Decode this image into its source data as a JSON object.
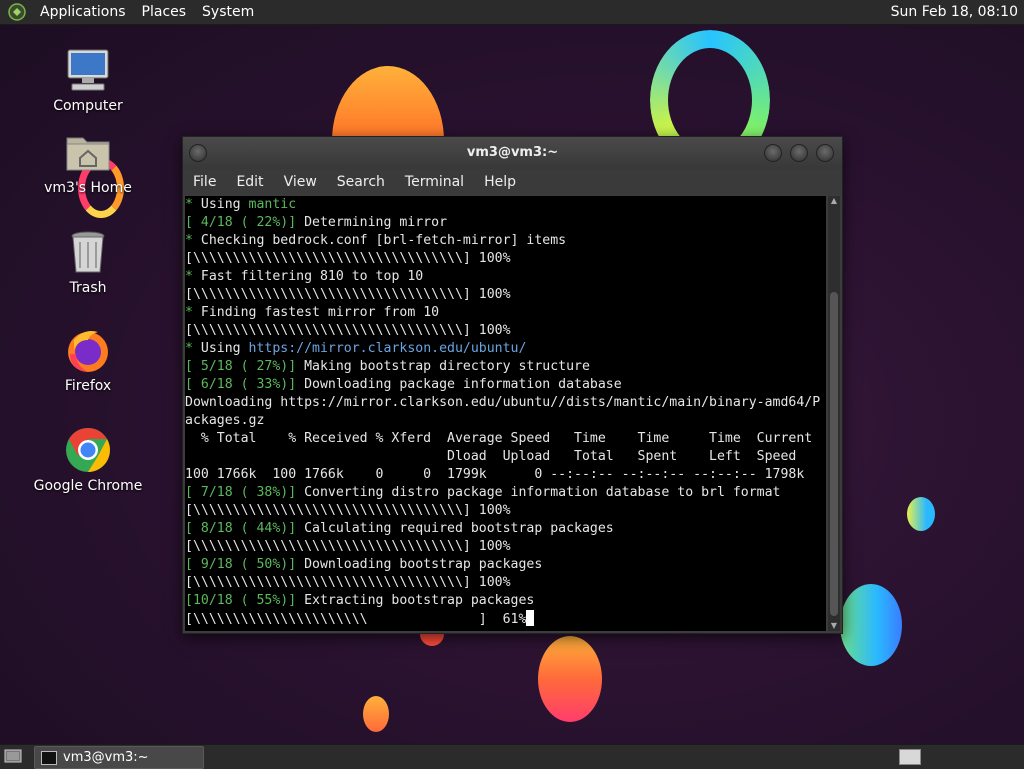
{
  "top_panel": {
    "menus": [
      "Applications",
      "Places",
      "System"
    ],
    "clock": "Sun Feb 18, 08:10"
  },
  "desktop_icons": [
    {
      "label": "Computer",
      "icon": "computer-icon"
    },
    {
      "label": "vm3's Home",
      "icon": "home-folder-icon"
    },
    {
      "label": "Trash",
      "icon": "trash-icon"
    },
    {
      "label": "Firefox",
      "icon": "firefox-icon"
    },
    {
      "label": "Google Chrome",
      "icon": "chrome-icon"
    }
  ],
  "window": {
    "title": "vm3@vm3:~",
    "menu": [
      "File",
      "Edit",
      "View",
      "Search",
      "Terminal",
      "Help"
    ]
  },
  "terminal": {
    "lines": [
      [
        {
          "t": "* ",
          "c": "g"
        },
        {
          "t": "Using "
        },
        {
          "t": "mantic",
          "c": "g"
        }
      ],
      [
        {
          "t": "[ 4/18 ( 22%)] ",
          "c": "g"
        },
        {
          "t": "Determining mirror"
        }
      ],
      [
        {
          "t": "* ",
          "c": "g"
        },
        {
          "t": "Checking bedrock.conf [brl-fetch-mirror] items"
        }
      ],
      [
        {
          "t": "[\\\\\\\\\\\\\\\\\\\\\\\\\\\\\\\\\\\\\\\\\\\\\\\\\\\\\\\\\\\\\\\\\\\\] 100%"
        }
      ],
      [
        {
          "t": "* ",
          "c": "g"
        },
        {
          "t": "Fast filtering 810 to top 10"
        }
      ],
      [
        {
          "t": "[\\\\\\\\\\\\\\\\\\\\\\\\\\\\\\\\\\\\\\\\\\\\\\\\\\\\\\\\\\\\\\\\\\\\] 100%"
        }
      ],
      [
        {
          "t": "* ",
          "c": "g"
        },
        {
          "t": "Finding fastest mirror from 10"
        }
      ],
      [
        {
          "t": "[\\\\\\\\\\\\\\\\\\\\\\\\\\\\\\\\\\\\\\\\\\\\\\\\\\\\\\\\\\\\\\\\\\\\] 100%"
        }
      ],
      [
        {
          "t": "* ",
          "c": "g"
        },
        {
          "t": "Using "
        },
        {
          "t": "https://mirror.clarkson.edu/ubuntu/",
          "c": "b"
        }
      ],
      [
        {
          "t": "[ 5/18 ( 27%)] ",
          "c": "g"
        },
        {
          "t": "Making bootstrap directory structure"
        }
      ],
      [
        {
          "t": "[ 6/18 ( 33%)] ",
          "c": "g"
        },
        {
          "t": "Downloading package information database"
        }
      ],
      [
        {
          "t": "Downloading https://mirror.clarkson.edu/ubuntu//dists/mantic/main/binary-amd64/P"
        }
      ],
      [
        {
          "t": "ackages.gz"
        }
      ],
      [
        {
          "t": "  % Total    % Received % Xferd  Average Speed   Time    Time     Time  Current"
        }
      ],
      [
        {
          "t": "                                 Dload  Upload   Total   Spent    Left  Speed"
        }
      ],
      [
        {
          "t": "100 1766k  100 1766k    0     0  1799k      0 --:--:-- --:--:-- --:--:-- 1798k"
        }
      ],
      [
        {
          "t": "[ 7/18 ( 38%)] ",
          "c": "g"
        },
        {
          "t": "Converting distro package information database to brl format"
        }
      ],
      [
        {
          "t": "[\\\\\\\\\\\\\\\\\\\\\\\\\\\\\\\\\\\\\\\\\\\\\\\\\\\\\\\\\\\\\\\\\\\\] 100%"
        }
      ],
      [
        {
          "t": "[ 8/18 ( 44%)] ",
          "c": "g"
        },
        {
          "t": "Calculating required bootstrap packages"
        }
      ],
      [
        {
          "t": "[\\\\\\\\\\\\\\\\\\\\\\\\\\\\\\\\\\\\\\\\\\\\\\\\\\\\\\\\\\\\\\\\\\\\] 100%"
        }
      ],
      [
        {
          "t": "[ 9/18 ( 50%)] ",
          "c": "g"
        },
        {
          "t": "Downloading bootstrap packages"
        }
      ],
      [
        {
          "t": "[\\\\\\\\\\\\\\\\\\\\\\\\\\\\\\\\\\\\\\\\\\\\\\\\\\\\\\\\\\\\\\\\\\\\] 100%"
        }
      ],
      [
        {
          "t": "[10/18 ( 55%)] ",
          "c": "g"
        },
        {
          "t": "Extracting bootstrap packages"
        }
      ],
      [
        {
          "t": "[\\\\\\\\\\\\\\\\\\\\\\\\\\\\\\\\\\\\\\\\\\\\              ]  61%"
        }
      ]
    ]
  },
  "taskbar": {
    "task_label": "vm3@vm3:~"
  },
  "colors": {
    "panel": "#2b2b2b",
    "terminal_bg": "#000000",
    "terminal_green": "#5cb85c",
    "terminal_link": "#6aa4e0"
  }
}
